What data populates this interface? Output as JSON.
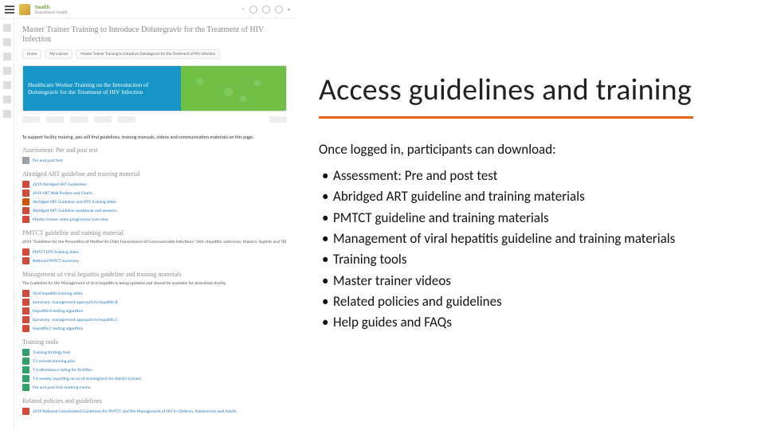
{
  "slide": {
    "heading": "Access guidelines and training",
    "lead": "Once logged in, participants can download:",
    "bullets": [
      "Assessment: Pre and post test",
      "Abridged ART guideline and training materials",
      "PMTCT guideline and training materials",
      "Management of viral hepatitis guideline and training materials",
      "Training tools",
      "Master trainer videos",
      "Related policies and guidelines",
      "Help guides and FAQs"
    ]
  },
  "mock": {
    "brand_title": "health",
    "brand_sub": "Department: Health",
    "page_title": "Master Trainer Training to Introduce Dolutegravir for the Treatment of HIV Infection",
    "crumbs": [
      "Home",
      "My courses",
      "Master Trainer Training to Introduce Dolutegravir for the Treatment of HIV Infection"
    ],
    "banner_title": "Healthcare Worker Training on the Introduction of Dolutegravir for the Treatment of HIV Infection",
    "intro": "To support facility training, you will find guidelines, training manuals, videos and communication materials on this page.",
    "sections": [
      {
        "title": "Assessment: Pre and post test",
        "items": [
          {
            "icon": "gry",
            "label": "Pre and post test"
          }
        ]
      },
      {
        "title": "Abridged ART guideline and training material",
        "items": [
          {
            "icon": "pdf",
            "label": "2019 Abridged ART Guidelines"
          },
          {
            "icon": "pdf",
            "label": "2019 ART Wall Posters and Charts"
          },
          {
            "icon": "ppt",
            "label": "Abridged ART Guideline and DTG training slides"
          },
          {
            "icon": "pdf",
            "label": "Abridged ART Guideline workbook and answers"
          },
          {
            "icon": "pdf",
            "label": "Master trainer video programme overview"
          }
        ]
      },
      {
        "title": "PMTCT guideline and training material",
        "subtext": "2019 \"Guideline for the Prevention of Mother-to-Child Transmission of Communicable Infections\" (HIV, Hepatitis, Listeriosis, Malaria, Syphilis and TB)",
        "items": [
          {
            "icon": "pdf",
            "label": "PMTCT DTG training slides"
          },
          {
            "icon": "pdf",
            "label": "National PMTCT summary"
          }
        ]
      },
      {
        "title": "Management of viral hepatitis guideline and training materials",
        "subtext": "The Guideline for the Management of viral hepatitis is being updated and should be available for download shortly.",
        "items": [
          {
            "icon": "pdf",
            "label": "Viral hepatitis training slides"
          },
          {
            "icon": "pdf",
            "label": "Summary: management approach to hepatitis B"
          },
          {
            "icon": "pdf",
            "label": "Hepatitis B testing algorithm"
          },
          {
            "icon": "pdf",
            "label": "Summary: management approach to hepatitis C"
          },
          {
            "icon": "pdf",
            "label": "Hepatitis C testing algorithm"
          }
        ]
      },
      {
        "title": "Training tools",
        "items": [
          {
            "icon": "grn",
            "label": "Training strategy tool"
          },
          {
            "icon": "grn",
            "label": "T-2 minute training plan"
          },
          {
            "icon": "grn",
            "label": "T-3 attendance listing for facilities"
          },
          {
            "icon": "grn",
            "label": "T-4 weekly reporting on no of dolutegravir for district trainers"
          },
          {
            "icon": "grn",
            "label": "Pre and post test marking memo"
          }
        ]
      },
      {
        "title": "Related policies and guidelines",
        "items": [
          {
            "icon": "pdf",
            "label": "2019 National Consolidated Guidelines for PMTCT and the Management of HIV in Children, Adolescents and Adults"
          }
        ]
      }
    ]
  }
}
